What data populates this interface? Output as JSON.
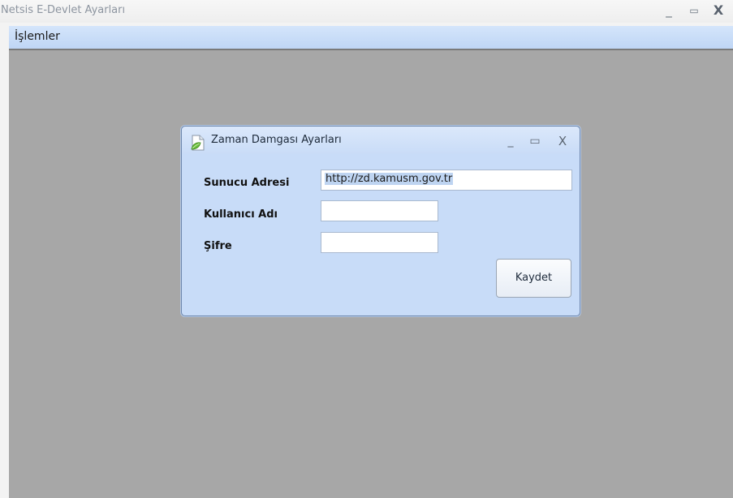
{
  "window": {
    "title": "Netsis E-Devlet Ayarları",
    "controls": {
      "minimize": "_",
      "maximize": "▭",
      "close": "X"
    }
  },
  "menu": {
    "items": [
      {
        "label": "İşlemler"
      }
    ]
  },
  "dialog": {
    "title": "Zaman Damgası Ayarları",
    "icon": "document-leaf-icon",
    "controls": {
      "minimize": "_",
      "maximize": "▭",
      "close": "X"
    },
    "fields": {
      "server": {
        "label": "Sunucu Adresi",
        "value": "http://zd.kamusm.gov.tr"
      },
      "username": {
        "label": "Kullanıcı Adı",
        "value": ""
      },
      "password": {
        "label": "Şifre",
        "value": ""
      }
    },
    "save_label": "Kaydet"
  },
  "colors": {
    "menu_bar": "#c9ddf8",
    "mdi_background": "#a7a7a7",
    "dialog_background": "#c8dcf8",
    "selection": "#bed4f1"
  }
}
